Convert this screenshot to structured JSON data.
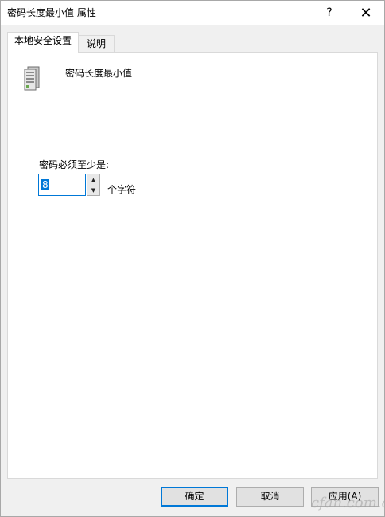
{
  "window": {
    "title": "密码长度最小值 属性",
    "help_glyph": "?",
    "close_glyph": "✕"
  },
  "tabs": [
    {
      "label": "本地安全设置",
      "active": true
    },
    {
      "label": "说明",
      "active": false
    }
  ],
  "policy": {
    "icon": "server-icon",
    "name": "密码长度最小值"
  },
  "setting": {
    "label": "密码必须至少是:",
    "value": "8",
    "unit": "个字符"
  },
  "buttons": {
    "ok": "确定",
    "cancel": "取消",
    "apply": "应用(A)"
  },
  "watermark": {
    "text": "cfan.com.cn"
  },
  "colors": {
    "accent": "#0078d7",
    "panel_bg": "#ffffff",
    "window_bg": "#f0f0f0"
  }
}
